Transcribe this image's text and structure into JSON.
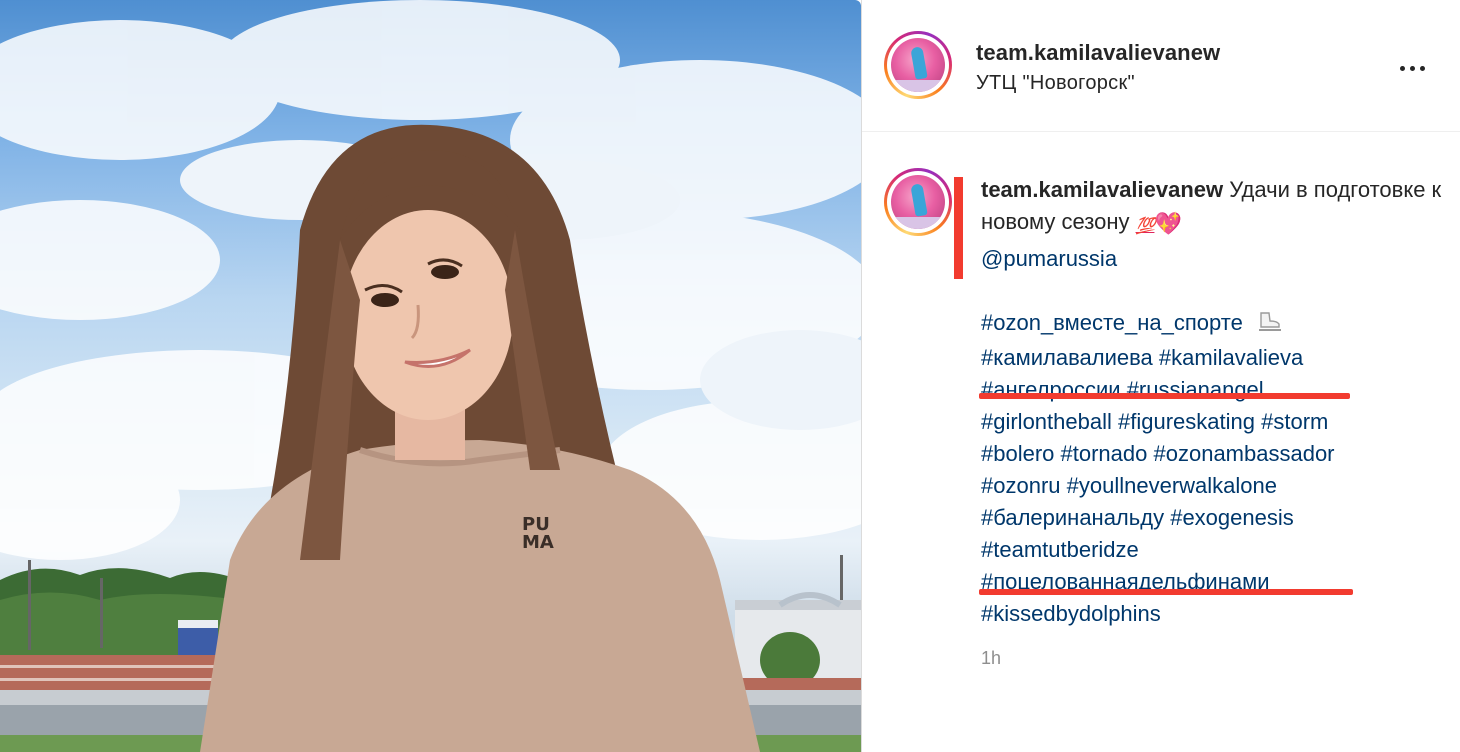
{
  "post": {
    "username": "team.kamilavalievanew",
    "location": "УТЦ \"Новогорск\"",
    "photo": {
      "shirt_logo": "PU\nMA",
      "icon": "photo-image"
    },
    "more_icon": "more-options-icon",
    "time": "1h"
  },
  "caption": {
    "username": "team.kamilavalievanew",
    "text": "Удачи в подготовке к новому сезону",
    "emoji": [
      "💯",
      "💖"
    ],
    "mention": "@pumarussia",
    "hashtag_lines": [
      [
        "#ozon_вместе_на_спорте"
      ],
      [
        "#камилавалиева",
        "#kamilavalieva"
      ],
      [
        "#ангелроссии",
        "#russianangel"
      ],
      [
        "#girlontheball",
        "#figureskating",
        "#storm"
      ],
      [
        "#bolero",
        "#tornado",
        "#ozonambassador"
      ],
      [
        "#ozonru",
        "#youllneverwalkalone"
      ],
      [
        "#балеринанальду",
        "#exogenesis"
      ],
      [
        "#teamtutberidze"
      ],
      [
        "#поцелованнаядельфинами"
      ],
      [
        "#kissedbydolphins"
      ]
    ],
    "line1_emoji_icon": "ice-skate-icon"
  },
  "colors": {
    "link": "#00376b",
    "text": "#262626",
    "muted": "#8e8e8e",
    "annotation_red": "#f23b2f"
  }
}
